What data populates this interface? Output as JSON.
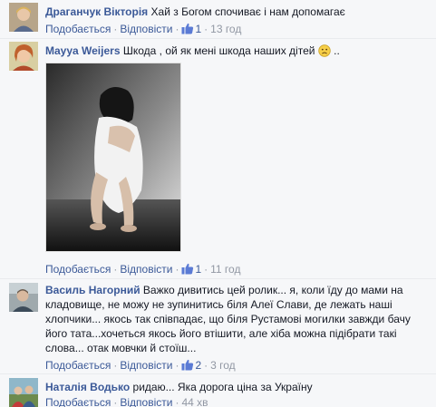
{
  "comments": [
    {
      "author": "Драганчук Вікторія",
      "text": "Хай з Богом спочиває і нам допомагає",
      "like_label": "Подобається",
      "reply_label": "Відповісти",
      "likes": "1",
      "time": "13 год"
    },
    {
      "author": "Mayya Weijers",
      "text": "Шкода , ой як мені шкода наших дітей",
      "text_suffix": "..",
      "like_label": "Подобається",
      "reply_label": "Відповісти",
      "likes": "1",
      "time": "11 год"
    },
    {
      "author": "Василь Нагорний",
      "text": "Важко дивитись цей ролик... я, коли їду до мами на кладовище, не можу не зупинитись біля Алеї Слави, де лежать наші хлопчики... якось так співпадає, що біля Рустамові могилки завжди бачу його тата...хочеться якось його втішити, але хіба можна підібрати такі слова... отак мовчки й стоїш...",
      "like_label": "Подобається",
      "reply_label": "Відповісти",
      "likes": "2",
      "time": "3 год"
    },
    {
      "author": "Наталія Водько",
      "text": "ридаю... Яка дорога ціна за Україну",
      "like_label": "Подобається",
      "reply_label": "Відповісти",
      "time": "44 хв"
    }
  ],
  "separator": "·",
  "colors": {
    "link": "#3b5998",
    "meta": "#9197a3",
    "text": "#141823"
  }
}
